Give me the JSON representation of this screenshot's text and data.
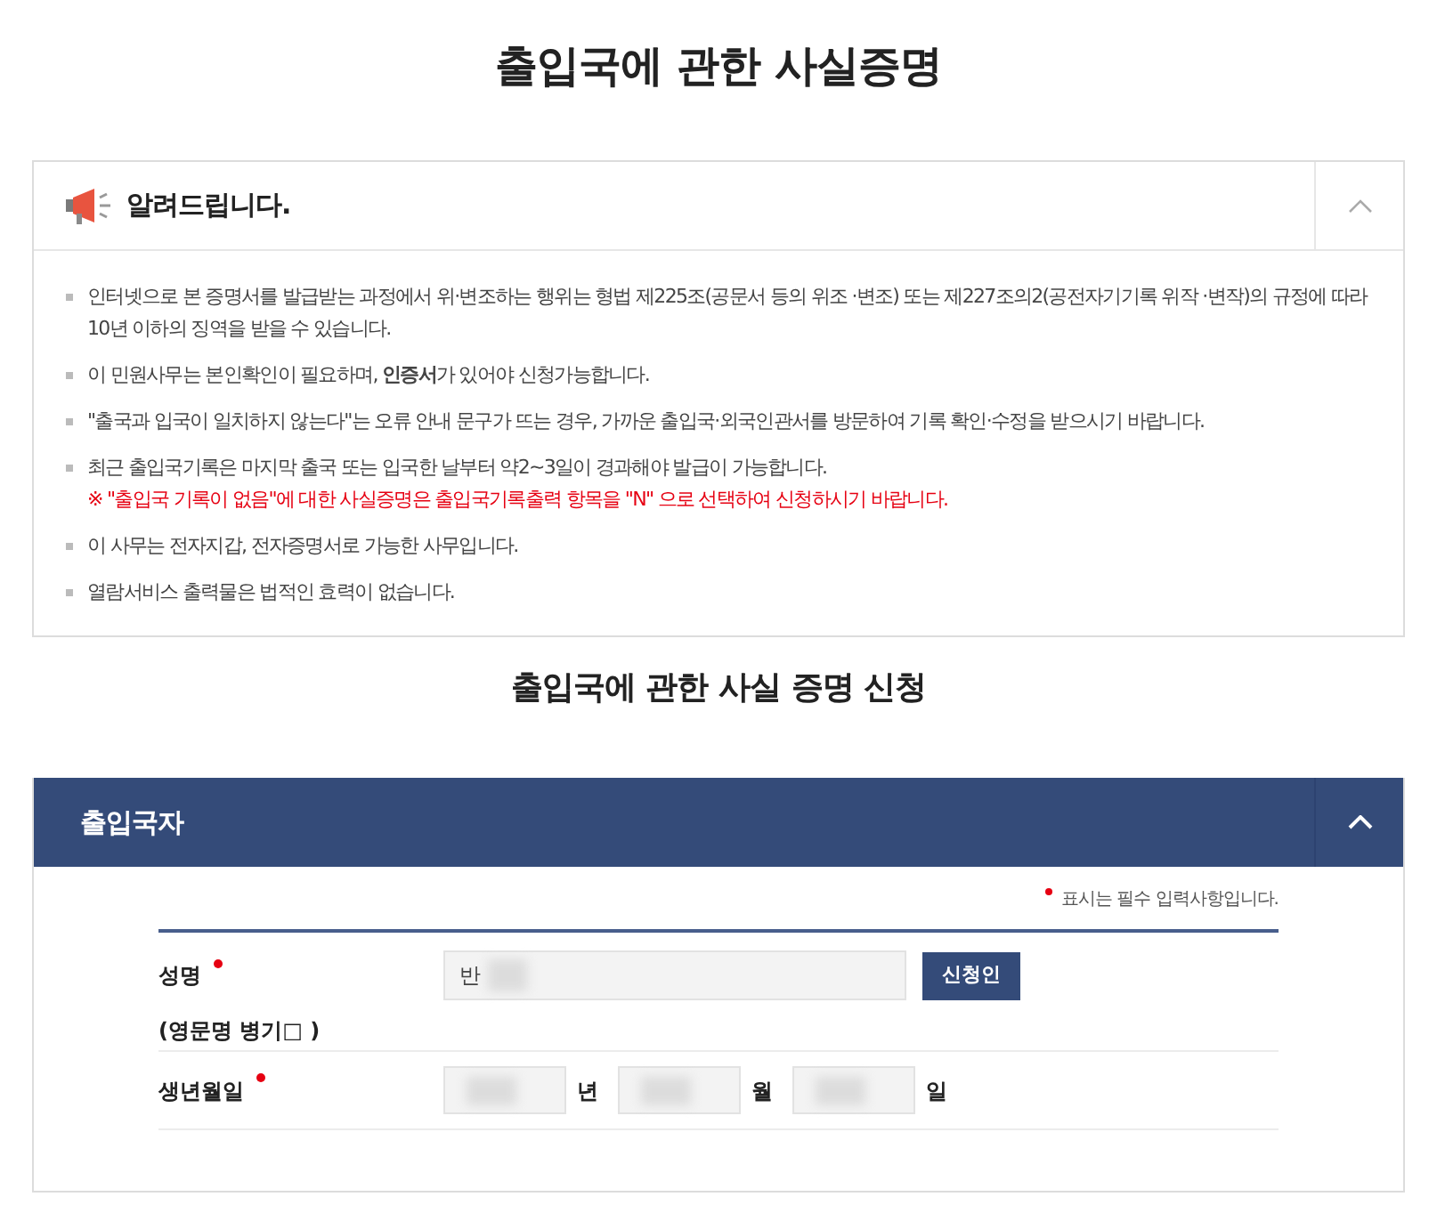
{
  "page_title": "출입국에 관한 사실증명",
  "notice": {
    "title": "알려드립니다.",
    "expanded": true,
    "items": [
      {
        "text": "인터넷으로 본 증명서를 발급받는 과정에서 위·변조하는 행위는 형법 제225조(공문서 등의 위조 ·변조) 또는 제227조의2(공전자기기록 위작 ·변작)의 규정에 따라 10년 이하의 징역을 받을 수 있습니다."
      },
      {
        "text": "이 민원사무는 본인확인이 필요하며, **인증서**가 있어야 신청가능합니다."
      },
      {
        "text": "\"출국과 입국이 일치하지 않는다\"는 오류 안내 문구가 뜨는 경우, 가까운 출입국·외국인관서를 방문하여 기록 확인·수정을 받으시기 바랍니다."
      },
      {
        "text": "최근 출입국기록은 마지막 출국 또는 입국한 날부터 약2~3일이 경과해야 발급이 가능합니다.",
        "note": "※ \"출입국 기록이 없음\"에 대한 사실증명은 출입국기록출력 항목을 \"N\" 으로 선택하여 신청하시기 바랍니다."
      },
      {
        "text": "이 사무는 전자지갑, 전자증명서로 가능한 사무입니다."
      },
      {
        "text": "열람서비스 출력물은 법적인 효력이 없습니다."
      }
    ]
  },
  "form_title": "출입국에 관한 사실 증명 신청",
  "applicant_panel": {
    "title": "출입국자",
    "expanded": true,
    "required_note": "표시는 필수 입력사항입니다.",
    "name_field": {
      "label": "성명",
      "required": true,
      "value": "반"
    },
    "applicant_button": "신청인",
    "english_name_note": "(영문명 병기□ )",
    "birth_date": {
      "label": "생년월일",
      "required": true,
      "fields": [
        {
          "unit": "년"
        },
        {
          "unit": "월"
        },
        {
          "unit": "일"
        }
      ]
    }
  }
}
